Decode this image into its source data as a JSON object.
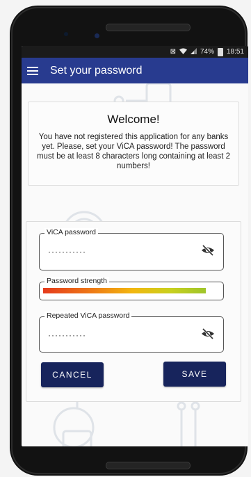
{
  "status_bar": {
    "battery": "74%",
    "time": "18:51"
  },
  "app_bar": {
    "title": "Set your password"
  },
  "welcome_card": {
    "title": "Welcome!",
    "message": "You have not registered this application for any banks yet. Please, set your ViCA password! The password must be at least 8 characters long containing at least 2 numbers!"
  },
  "form": {
    "password": {
      "label": "ViCA password",
      "value": "···········"
    },
    "strength": {
      "label": "Password strength",
      "level": 0.92
    },
    "repeat_password": {
      "label": "Repeated ViCA password",
      "value": "···········"
    },
    "cancel_label": "CANCEL",
    "save_label": "SAVE"
  },
  "colors": {
    "app_bar": "#283b8f",
    "button": "#17245c"
  }
}
